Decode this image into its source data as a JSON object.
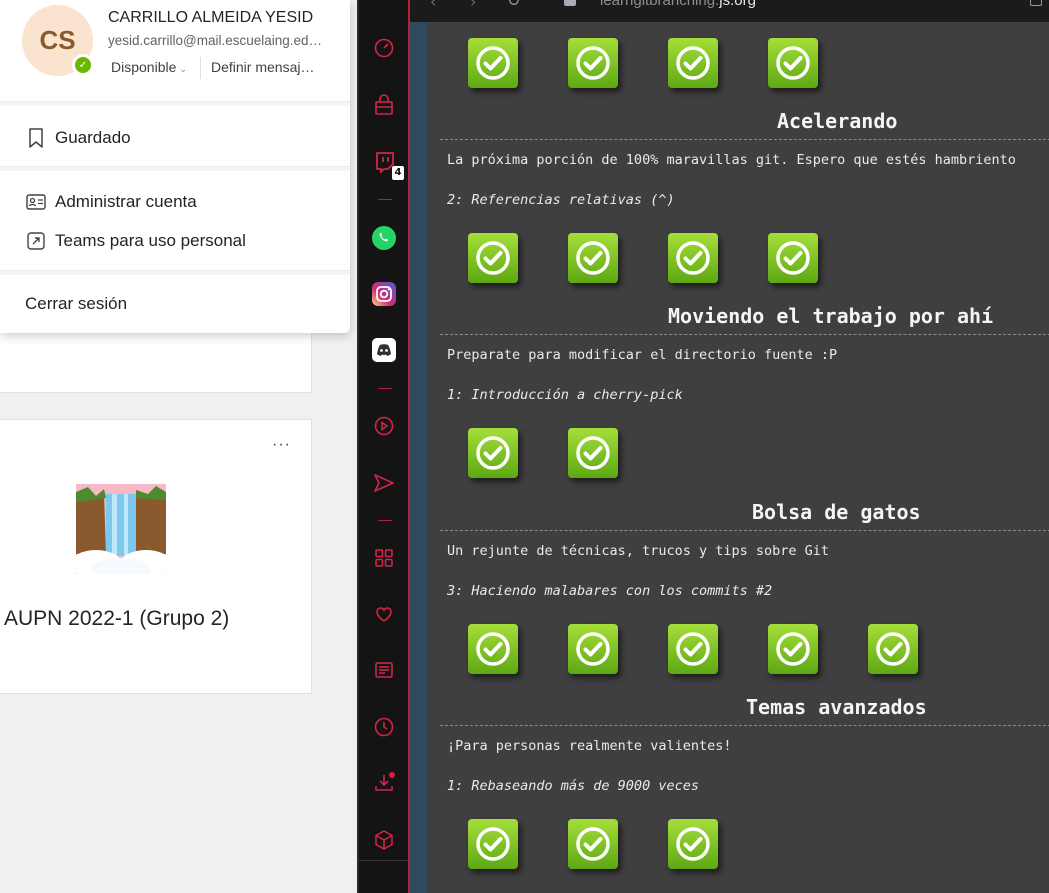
{
  "teams": {
    "profile": {
      "initials": "CS",
      "name": "CARRILLO ALMEIDA YESID",
      "email": "yesid.carrillo@mail.escuelaing.edu.co",
      "status": "Disponible",
      "set_message": "Definir mensaje de estado"
    },
    "menu": {
      "saved": "Guardado",
      "manage_account": "Administrar cuenta",
      "teams_personal": "Teams para uso personal",
      "sign_out": "Cerrar sesión"
    },
    "team_card": {
      "more": "···",
      "name": "AUPN 2022-1 (Grupo 2)"
    }
  },
  "browser_sidebar": {
    "twitch_badge": "4"
  },
  "browser": {
    "url_host": "learngitbranching.",
    "url_tld": "js.org",
    "sections": [
      {
        "title": "Acelerando",
        "description": "La próxima porción de 100% maravillas git. Espero que estés hambriento",
        "level": "2: Referencias relativas (^)"
      },
      {
        "title": "Moviendo el trabajo por ahí",
        "description": "Preparate para modificar el directorio fuente :P",
        "level": "1: Introducción a cherry-pick"
      },
      {
        "title": "Bolsa de gatos",
        "description": "Un rejunte de técnicas, trucos y tips sobre Git",
        "level": "3: Haciendo malabares con los commits #2"
      },
      {
        "title": "Temas avanzados",
        "description": "¡Para personas realmente valientes!",
        "level": "1: Rebaseando más de 9000 veces"
      }
    ],
    "level_rows": [
      {
        "completed": 4
      },
      {
        "completed": 4
      },
      {
        "completed": 2
      },
      {
        "completed": 5
      },
      {
        "completed": 3
      }
    ],
    "accent_color": "#7cc11f"
  }
}
